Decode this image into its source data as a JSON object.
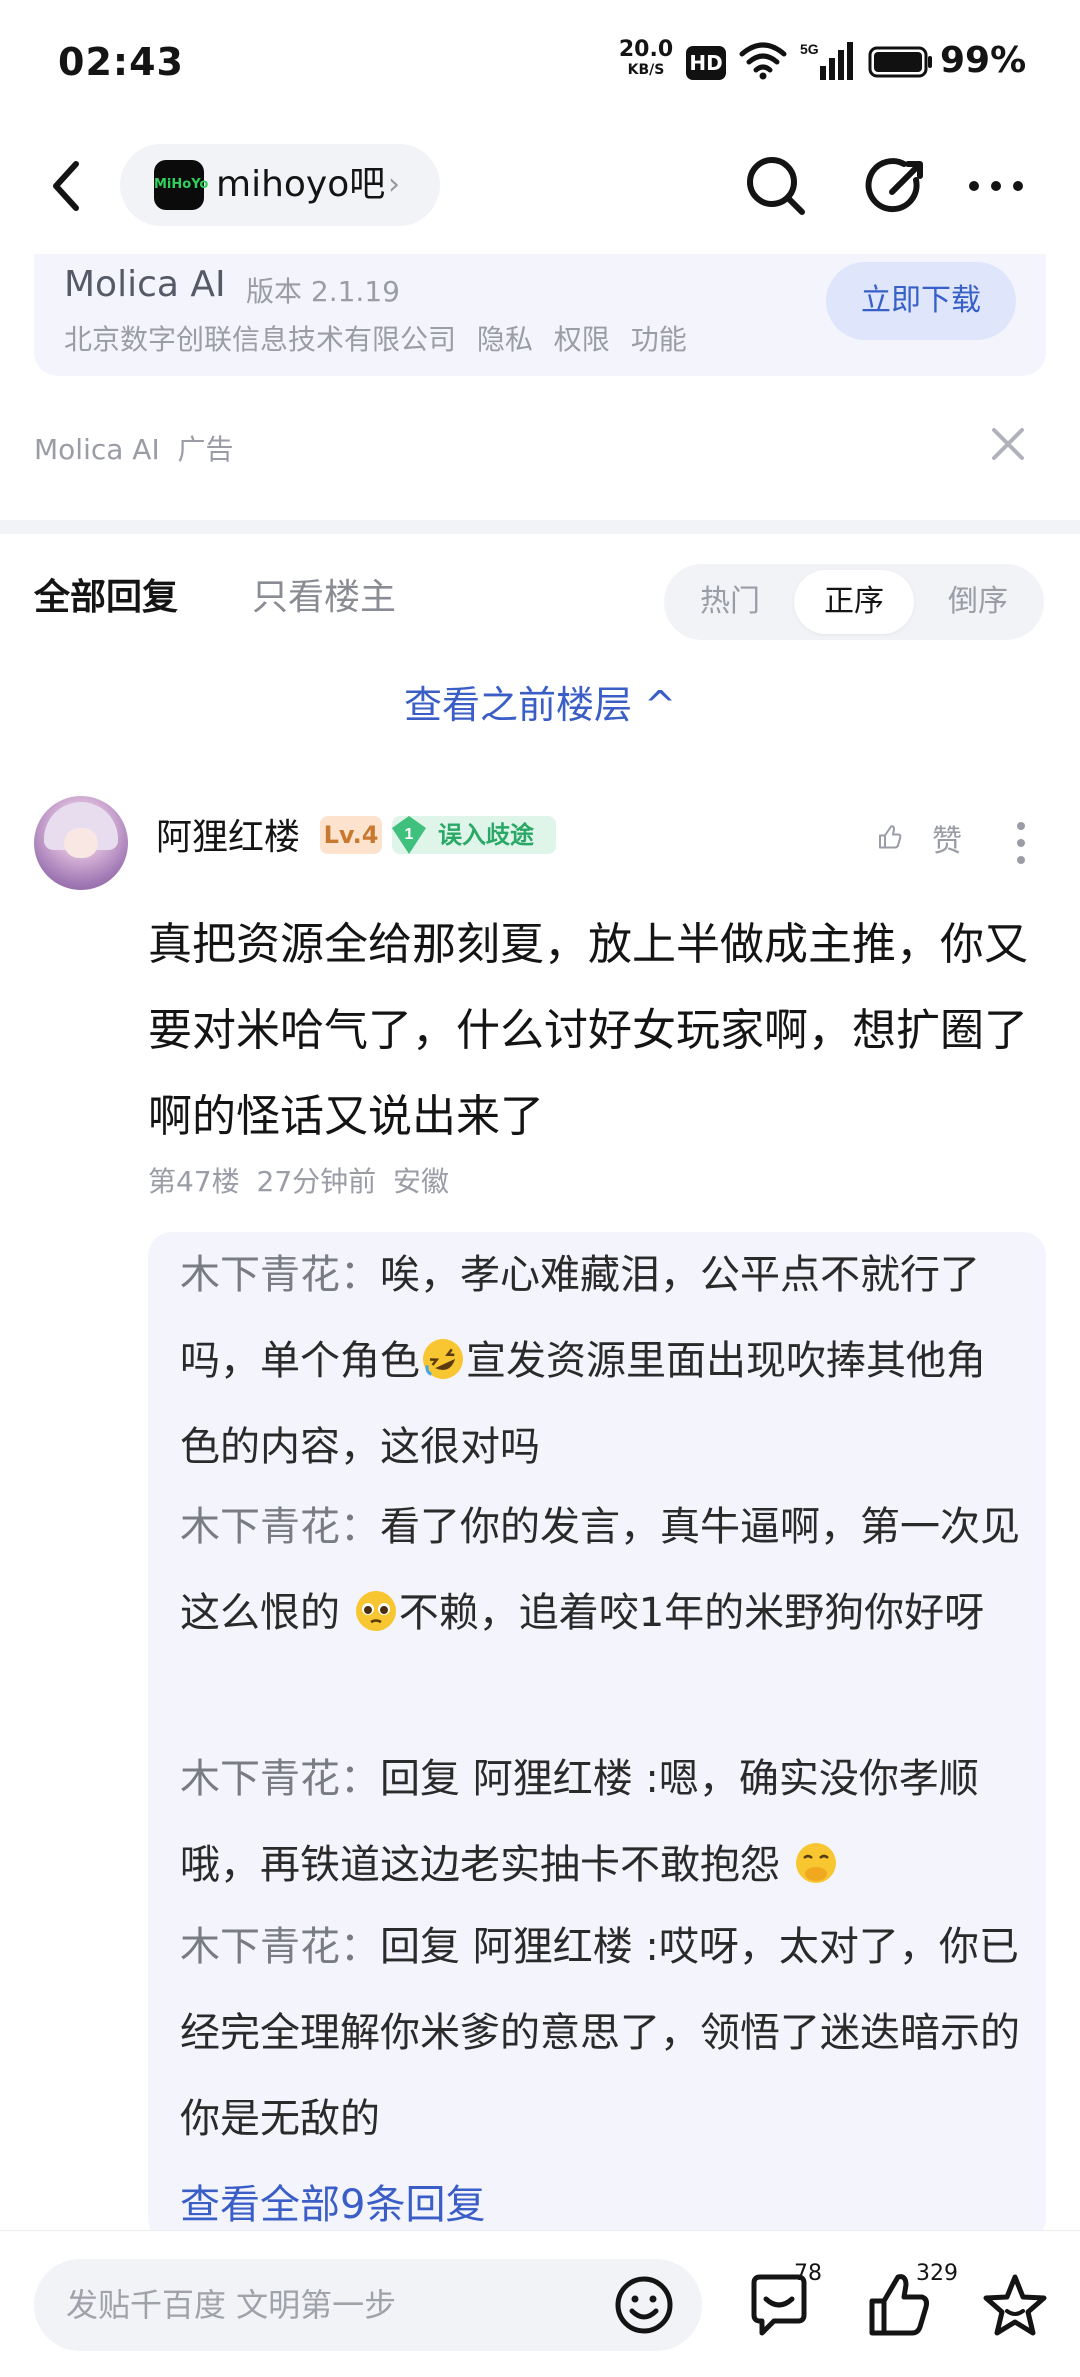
{
  "status_bar": {
    "time": "02:43",
    "net_speed_value": "20.0",
    "net_speed_unit": "KB/S",
    "hd": "HD",
    "network": "5G",
    "battery": "99%"
  },
  "nav": {
    "forum_name": "mihoyo吧",
    "forum_logo_text": "MiHoYo"
  },
  "ad": {
    "app_name": "Molica AI",
    "version": "版本 2.1.19",
    "company_links": "北京数字创联信息技术有限公司 隐私 权限 功能",
    "download_label": "立即下载",
    "label": "Molica AI  广告"
  },
  "tabs": {
    "all_replies": "全部回复",
    "op_only": "只看楼主",
    "sort": [
      "热门",
      "正序",
      "倒序"
    ],
    "active_sort": "正序"
  },
  "prev_floors_label": "查看之前楼层 ^",
  "post": {
    "username": "阿狸红楼",
    "level": "Lv.4",
    "title_badge_num": "1",
    "title_badge": "误入歧途",
    "like_label": "赞",
    "body": "真把资源全给那刻夏，放上半做成主推，你又要对米哈气了，什么讨好女玩家啊，想扩圈了啊的怪话又说出来了",
    "meta": "第47楼 27分钟前 安徽"
  },
  "replies": {
    "items": [
      {
        "author": "木下青花：",
        "text_a": "唉，孝心难藏泪，公平点不就行了吗，单个角色",
        "emoji": "rofl-emoji",
        "text_b": "宣发资源里面出现吹捧其他角色的内容，这很对吗"
      },
      {
        "author": "木下青花：",
        "text_a": "看了你的发言，真牛逼啊，第一次见这么恨的 ",
        "emoji": "pleading-emoji",
        "text_b": "不赖，追着咬1年的米野狗你好呀"
      },
      {
        "author": "木下青花：",
        "text_a": "回复 阿狸红楼 :嗯，确实没你孝顺哦，再铁道这边老实抽卡不敢抱怨 ",
        "emoji": "hand-over-mouth-emoji",
        "text_b": ""
      },
      {
        "author": "木下青花：",
        "text_a": "回复 阿狸红楼 :哎呀，太对了，你已经完全理解你米爹的意思了，领悟了迷迭暗示的你是无敌的",
        "emoji": "",
        "text_b": ""
      }
    ],
    "view_all": "查看全部9条回复"
  },
  "bottom_bar": {
    "placeholder": "发贴千百度 文明第一步",
    "comments_count": "78",
    "likes_count": "329"
  },
  "colors": {
    "link_blue": "#3a5ec6",
    "reply_bg": "#f4f4fd",
    "badge_green": "#2aa866",
    "level_orange": "#c77a2f"
  }
}
